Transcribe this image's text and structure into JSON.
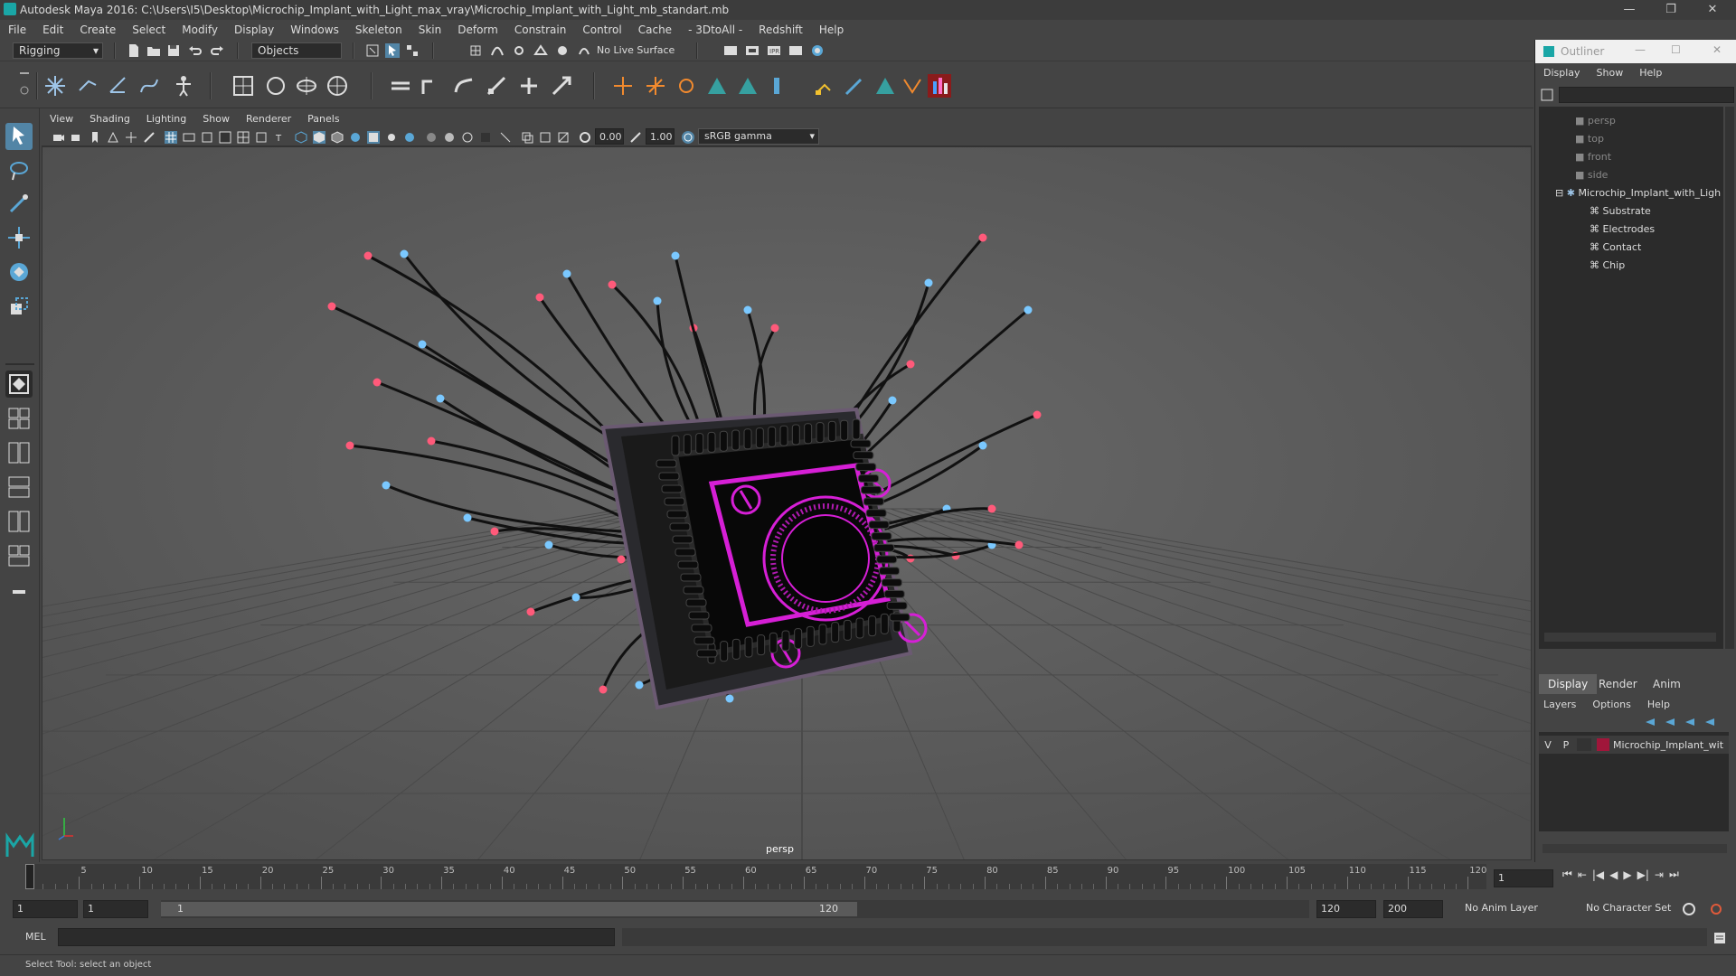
{
  "window": {
    "title": "Autodesk Maya 2016: C:\\Users\\I5\\Desktop\\Microchip_Implant_with_Light_max_vray\\Microchip_Implant_with_Light_mb_standart.mb",
    "minimize": "—",
    "restore": "❐",
    "close": "✕"
  },
  "menubar": [
    "File",
    "Edit",
    "Create",
    "Select",
    "Modify",
    "Display",
    "Windows",
    "Skeleton",
    "Skin",
    "Deform",
    "Constrain",
    "Control",
    "Cache",
    "- 3DtoAll -",
    "Redshift",
    "Help"
  ],
  "statusline": {
    "mode": "Rigging",
    "selection_mode": "Objects",
    "live_surface": "No Live Surface"
  },
  "panel": {
    "menu": [
      "View",
      "Shading",
      "Lighting",
      "Show",
      "Renderer",
      "Panels"
    ],
    "exposure": "0.00",
    "gamma": "1.00",
    "colorspace": "sRGB gamma",
    "camera_label": "persp"
  },
  "outliner": {
    "title": "Outliner",
    "menu": [
      "Display",
      "Show",
      "Help"
    ],
    "items": [
      {
        "label": "persp",
        "dim": true
      },
      {
        "label": "top",
        "dim": true
      },
      {
        "label": "front",
        "dim": true
      },
      {
        "label": "side",
        "dim": true
      },
      {
        "label": "Microchip_Implant_with_Ligh",
        "dim": false
      },
      {
        "label": "Substrate",
        "dim": false
      },
      {
        "label": "Electrodes",
        "dim": false
      },
      {
        "label": "Contact",
        "dim": false
      },
      {
        "label": "Chip",
        "dim": false
      }
    ]
  },
  "layer_editor": {
    "tabs": [
      "Display",
      "Render",
      "Anim"
    ],
    "menu": [
      "Layers",
      "Options",
      "Help"
    ],
    "layer": {
      "v": "V",
      "p": "P",
      "name": "Microchip_Implant_wit",
      "color": "#a0163a"
    }
  },
  "timeline": {
    "ticks": [
      "5",
      "10",
      "15",
      "20",
      "25",
      "30",
      "35",
      "40",
      "45",
      "50",
      "55",
      "60",
      "65",
      "70",
      "75",
      "80",
      "85",
      "90",
      "95",
      "100",
      "105",
      "110",
      "115",
      "120"
    ],
    "current_frame": "1"
  },
  "range": {
    "start": "1",
    "start_inner": "1",
    "slider_start": "1",
    "slider_end": "120",
    "end_inner": "120",
    "end": "200",
    "anim_layer": "No Anim Layer",
    "character_set": "No Character Set"
  },
  "command": {
    "label": "MEL"
  },
  "help_line": "Select Tool: select an object",
  "colors": {
    "accent": "#5285a6",
    "chip_glow": "#d61fd6",
    "bg": "#444444"
  }
}
